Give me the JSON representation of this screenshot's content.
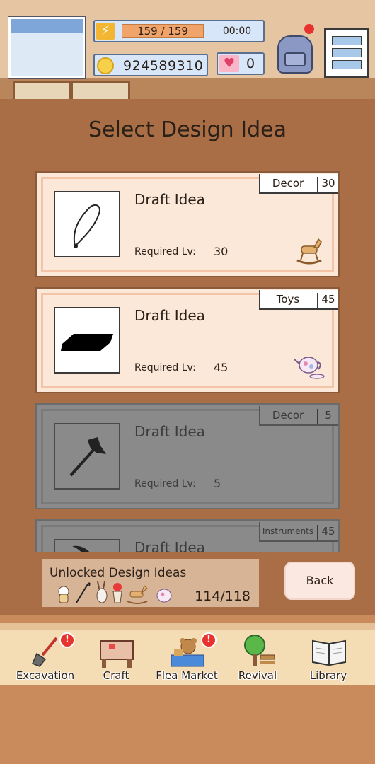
{
  "status": {
    "energy": "159 / 159",
    "timer": "00:00",
    "coins": "924589310",
    "hearts": "0"
  },
  "panel": {
    "title": "Select Design Idea"
  },
  "cards": [
    {
      "category": "Decor",
      "count": "30",
      "title": "Draft Idea",
      "req_label": "Required Lv:",
      "level": "30",
      "locked": false,
      "reward_icon": "rocking-horse-icon"
    },
    {
      "category": "Toys",
      "count": "45",
      "title": "Draft Idea",
      "req_label": "Required Lv:",
      "level": "45",
      "locked": false,
      "reward_icon": "teapot-icon"
    },
    {
      "category": "Decor",
      "count": "5",
      "title": "Draft Idea",
      "req_label": "Required Lv:",
      "level": "5",
      "locked": true
    },
    {
      "category": "Instruments",
      "count": "45",
      "title": "Draft Idea",
      "locked": true
    }
  ],
  "unlocked": {
    "label": "Unlocked Design Ideas",
    "count": "114/118"
  },
  "back_label": "Back",
  "nav": [
    {
      "label": "Excavation",
      "alert": "!"
    },
    {
      "label": "Craft"
    },
    {
      "label": "Flea Market",
      "alert": "!"
    },
    {
      "label": "Revival"
    },
    {
      "label": "Library"
    }
  ],
  "colors": {
    "panel": "#aa6e46",
    "card": "#fbe8d8",
    "locked_card": "#8a8a8a",
    "alert": "#e8322e"
  }
}
